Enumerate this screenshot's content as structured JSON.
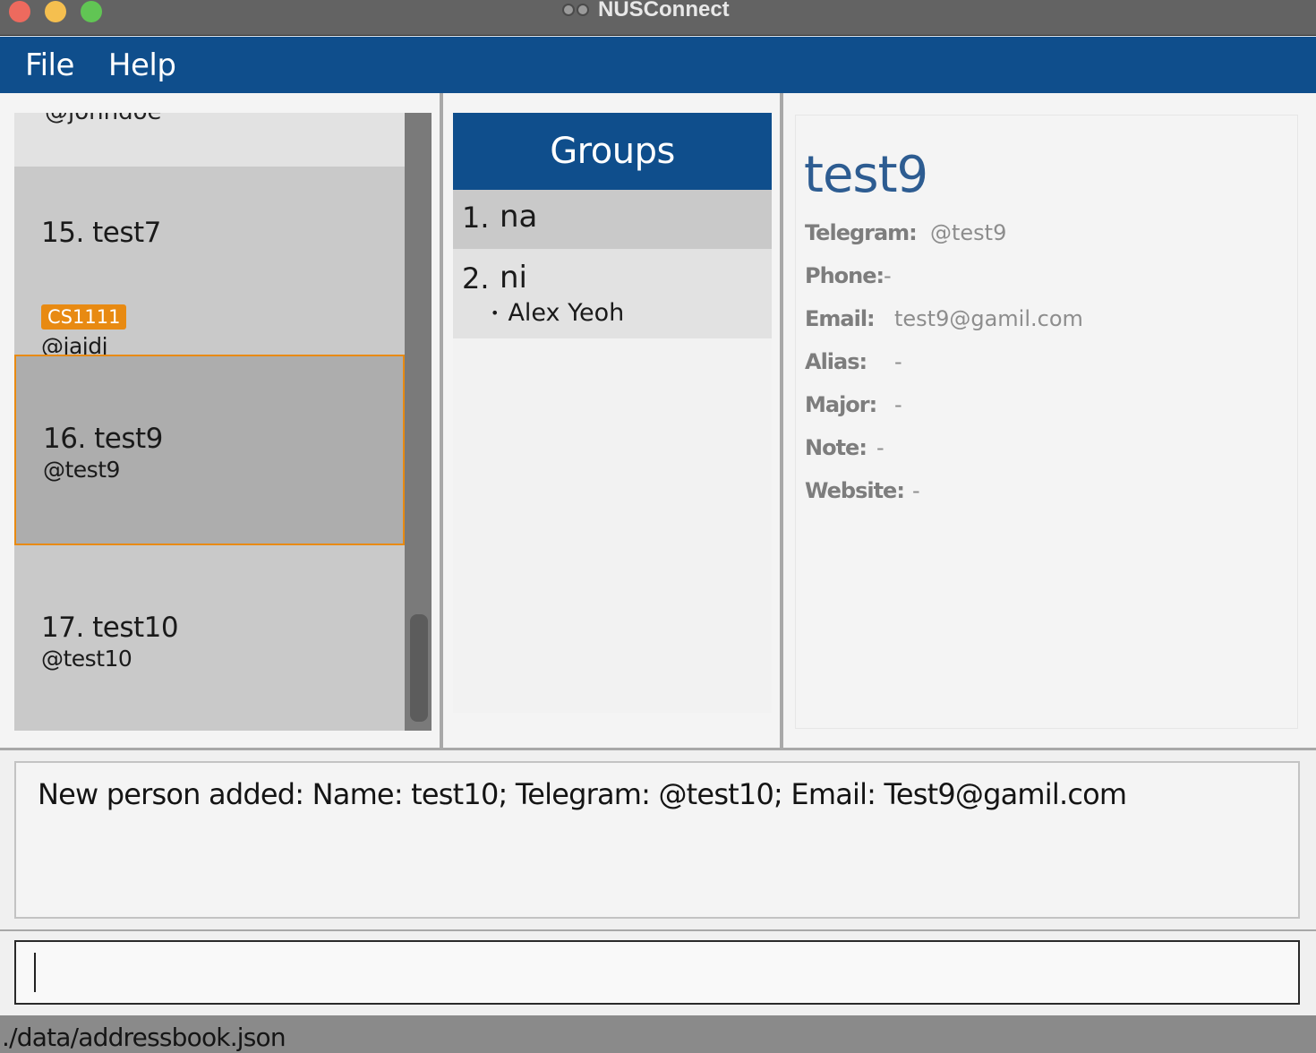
{
  "window": {
    "title": "NUSConnect",
    "controls": [
      "close",
      "minimize",
      "maximize"
    ]
  },
  "menu": {
    "file": "File",
    "help": "Help"
  },
  "person_list": {
    "top_partial_handle": "@johndoe",
    "persons": [
      {
        "name": "15. test7",
        "tag": "CS1111",
        "handle": "@jajdj"
      },
      {
        "name": "16. test9",
        "handle": "@test9",
        "selected": true
      },
      {
        "name": "17. test10",
        "handle": "@test10"
      }
    ]
  },
  "groups": {
    "header": "Groups",
    "items": [
      {
        "index": "1.",
        "name": "na",
        "members": []
      },
      {
        "index": "2.",
        "name": "ni",
        "members": [
          "Alex Yeoh"
        ]
      }
    ]
  },
  "details": {
    "name": "test9",
    "telegram_label": "Telegram:",
    "telegram": "@test9",
    "phone_label": "Phone:",
    "phone": "-",
    "email_label": "Email:",
    "email": "test9@gamil.com",
    "alias_label": "Alias:",
    "alias": "-",
    "major_label": "Major:",
    "major": "-",
    "note_label": "Note:",
    "note": "-",
    "website_label": "Website:",
    "website": "-"
  },
  "result": {
    "message": "New person added: Name: test10; Telegram: @test10; Email: Test9@gamil.com"
  },
  "command": {
    "value": ""
  },
  "status": {
    "path": "./data/addressbook.json"
  },
  "colors": {
    "accent": "#0f4e8c",
    "tag": "#e88a12",
    "detail_name": "#2d5c91"
  }
}
